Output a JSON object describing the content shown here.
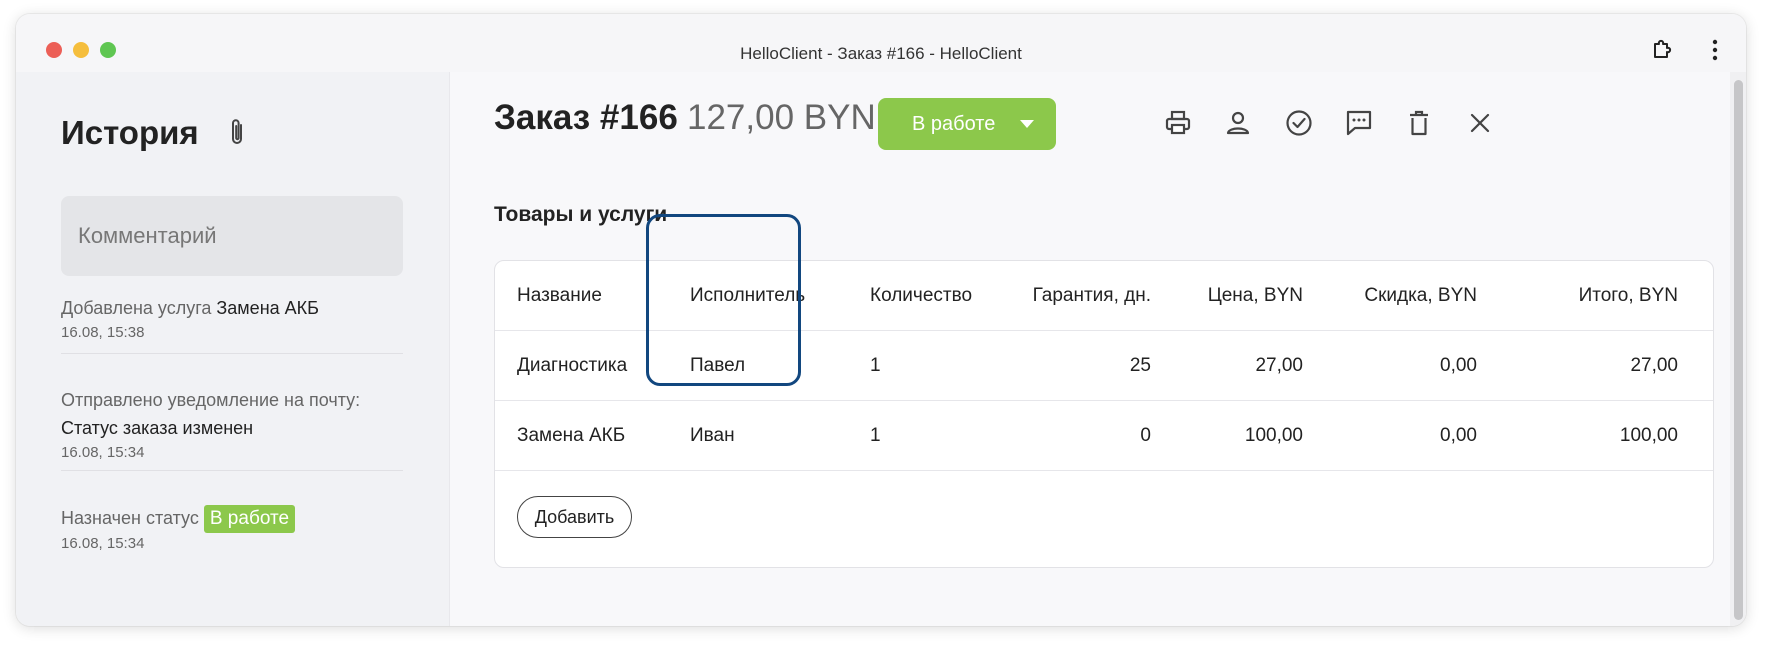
{
  "window": {
    "title": "HelloClient - Заказ #166 - HelloClient"
  },
  "sidebar": {
    "title": "История",
    "comment_placeholder": "Комментарий",
    "history": [
      {
        "prefix": "Добавлена услуга ",
        "highlight": "Замена АКБ",
        "time": "16.08, 15:38"
      },
      {
        "prefix": "Отправлено уведомление на почту: ",
        "highlight": "Статус заказа изменен",
        "time": "16.08, 15:34"
      },
      {
        "prefix": "Назначен статус ",
        "badge": "В работе",
        "time": "16.08, 15:34"
      }
    ]
  },
  "order": {
    "title": "Заказ #166",
    "total": "127,00 BYN",
    "status": "В работе"
  },
  "toolbar": {
    "icons": [
      "printer-icon",
      "person-icon",
      "check-circle-icon",
      "message-icon",
      "trash-icon",
      "close-icon"
    ]
  },
  "section": {
    "title": "Товары и услуги"
  },
  "table": {
    "headers": [
      "Название",
      "Исполнитель",
      "Количество",
      "Гарантия, дн.",
      "Цена, BYN",
      "Скидка, BYN",
      "Итого, BYN"
    ],
    "rows": [
      [
        "Диагностика",
        "Павел",
        "1",
        "25",
        "27,00",
        "0,00",
        "27,00"
      ],
      [
        "Замена АКБ",
        "Иван",
        "1",
        "0",
        "100,00",
        "0,00",
        "100,00"
      ]
    ],
    "add_label": "Добавить"
  },
  "colors": {
    "status_green": "#8cc84b",
    "highlight_border": "#12477f"
  }
}
